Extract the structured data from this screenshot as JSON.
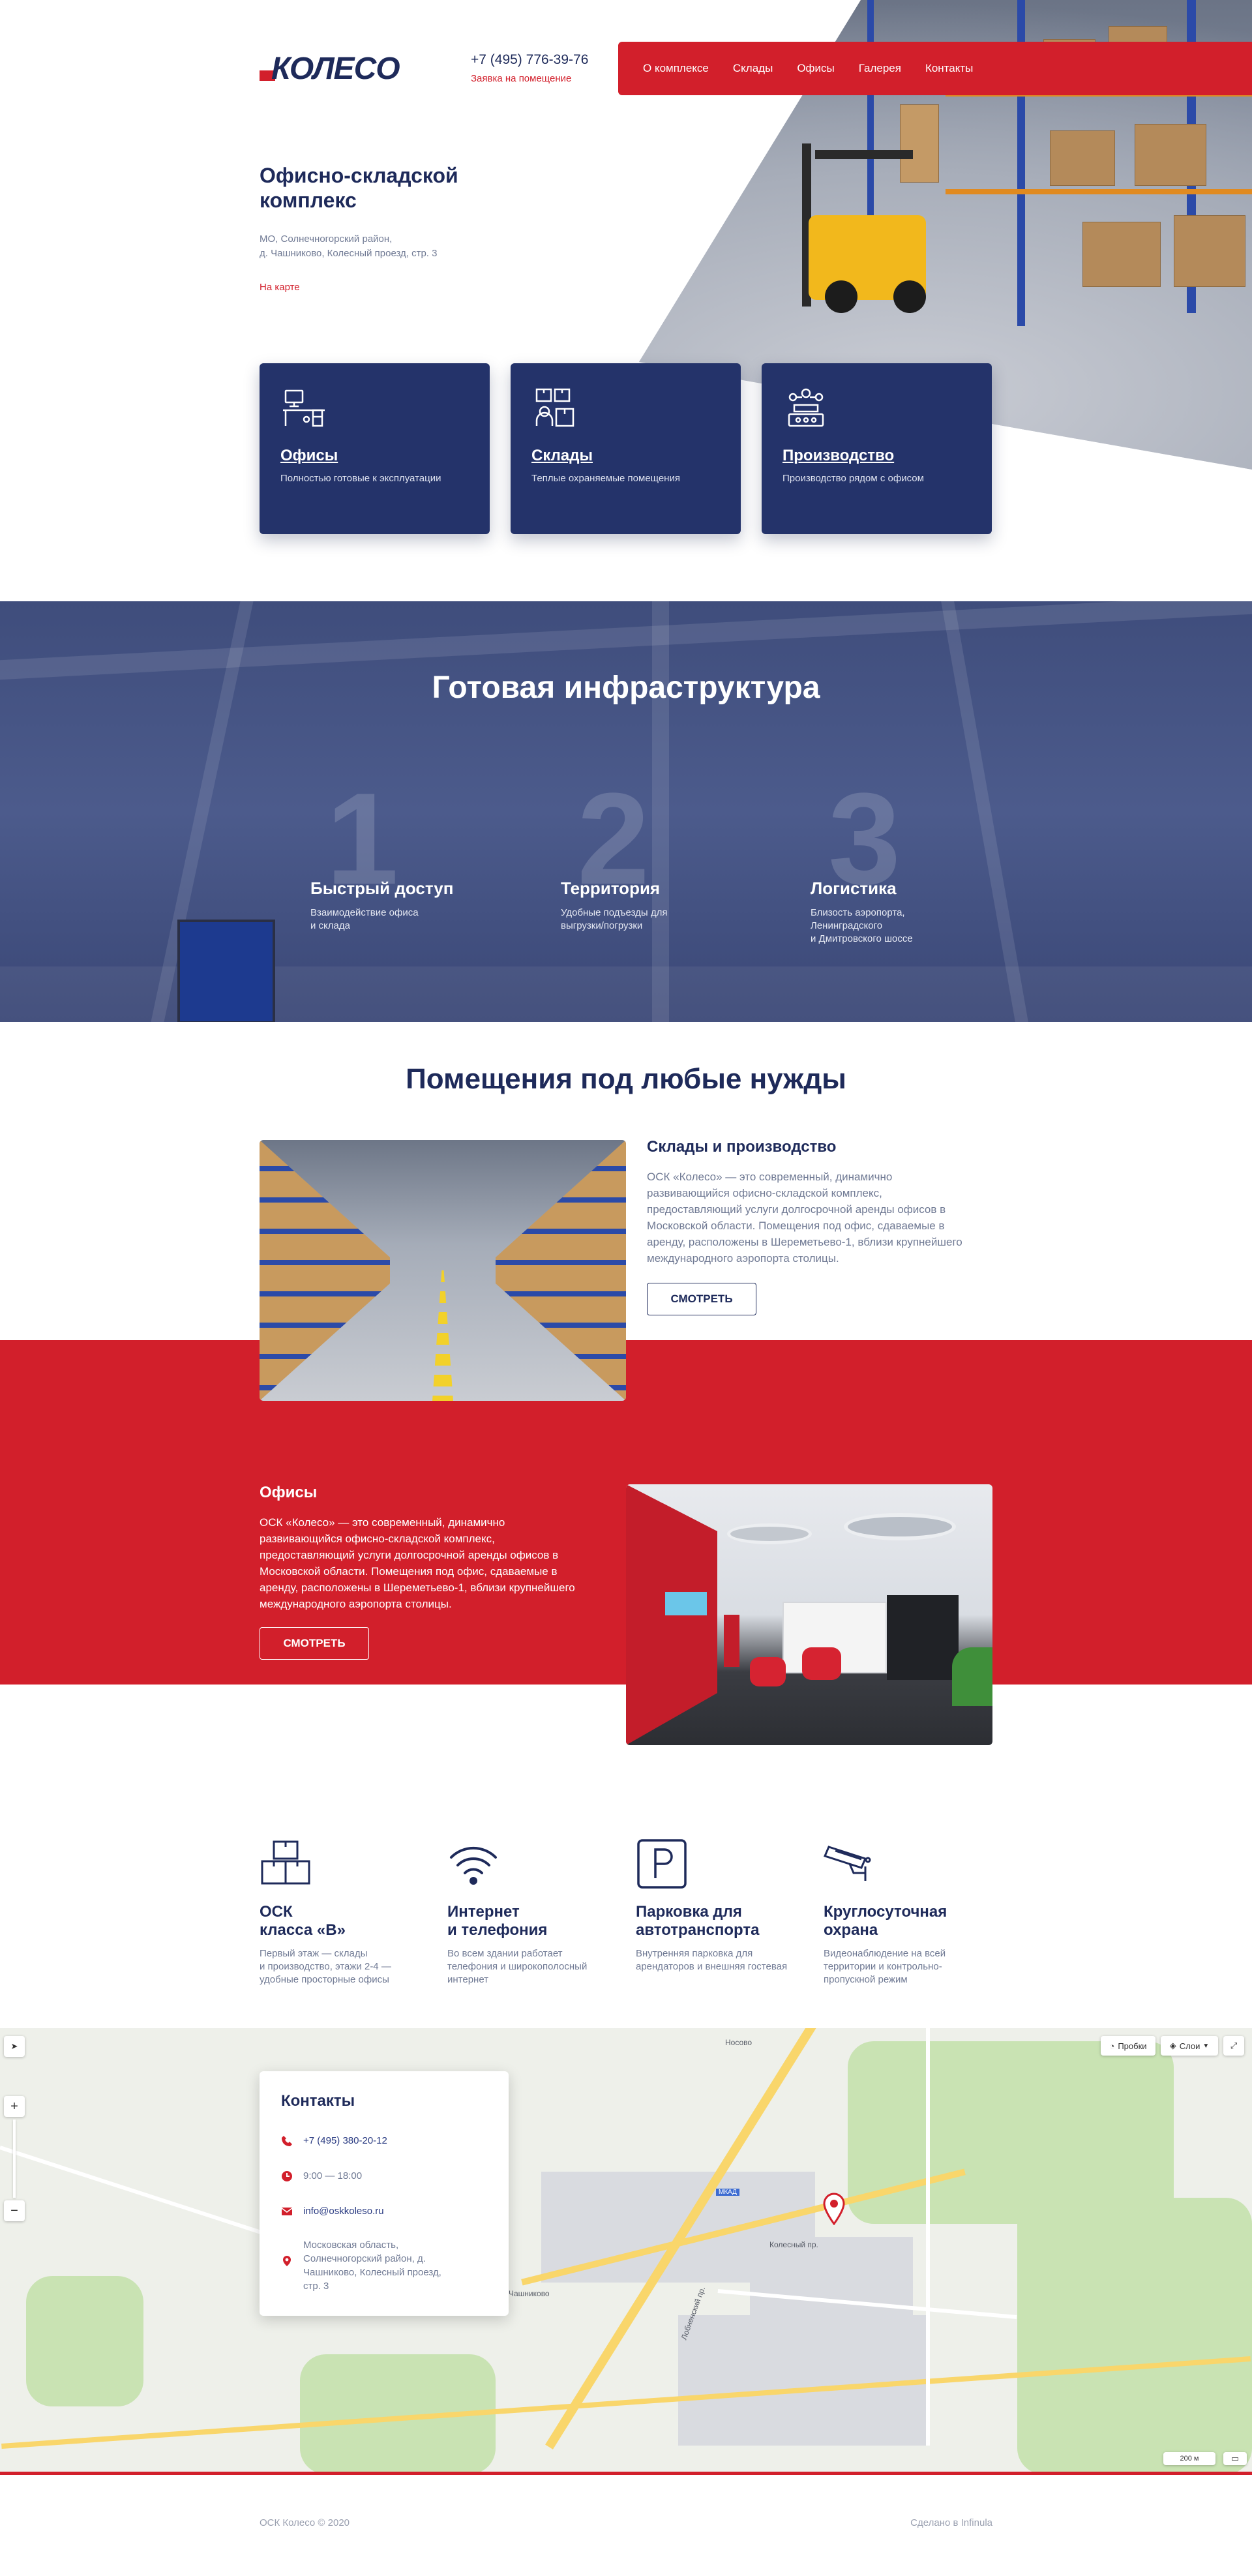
{
  "header": {
    "logo_text": "КОЛЕСО",
    "phone": "+7 (495) 776-39-76",
    "request_link": "Заявка на помещение",
    "nav": [
      "О комплексе",
      "Склады",
      "Офисы",
      "Галерея",
      "Контакты"
    ]
  },
  "hero": {
    "title": "Офисно-складской комплекс",
    "address_line1": "МО, Солнечногорский район,",
    "address_line2": "д. Чашниково, Колесный проезд, стр. 3",
    "map_link": "На карте"
  },
  "cards": [
    {
      "title": "Офисы",
      "subtitle": "Полностью готовые к эксплуатации",
      "icon": "office-desk-icon"
    },
    {
      "title": "Склады",
      "subtitle": "Теплые охраняемые помещения",
      "icon": "warehouse-boxes-icon"
    },
    {
      "title": "Производство",
      "subtitle": "Производство рядом с офисом",
      "icon": "production-icon"
    }
  ],
  "infrastructure": {
    "title": "Готовая инфраструктура",
    "features": [
      {
        "num": "1",
        "title": "Быстрый доступ",
        "line1": "Взаимодействие офиса",
        "line2": "и склада",
        "line3": ""
      },
      {
        "num": "2",
        "title": "Территория",
        "line1": "Удобные подъезды для",
        "line2": "выгрузки/погрузки",
        "line3": ""
      },
      {
        "num": "3",
        "title": "Логистика",
        "line1": "Близость аэропорта,",
        "line2": "Ленинградского",
        "line3": "и Дмитровского шоссе"
      }
    ]
  },
  "rooms": {
    "title": "Помещения под любые нужды",
    "warehouses": {
      "title": "Склады и производство",
      "text": "ОСК «Колесо» — это современный, динамично развивающийся офисно-складской комплекс, предоставляющий услуги долгосрочной аренды офисов в Московской области. Помещения под офис, сдаваемые в аренду, расположены в Шереметьево-1, вблизи крупнейшего международного аэропорта столицы.",
      "button": "СМОТРЕТЬ"
    },
    "offices": {
      "title": "Офисы",
      "text": "ОСК «Колесо» — это современный, динамично развивающийся офисно-складской комплекс, предоставляющий услуги долгосрочной аренды офисов в Московской области. Помещения под офис, сдаваемые в аренду, расположены в Шереметьево-1, вблизи крупнейшего международного аэропорта столицы.",
      "button": "СМОТРЕТЬ"
    }
  },
  "amenities": [
    {
      "title1": "ОСК",
      "title2": "класса «В»",
      "line1": "Первый этаж — склады",
      "line2": "и производство, этажи 2-4 —",
      "line3": "удобные просторные офисы",
      "icon": "boxes-icon"
    },
    {
      "title1": "Интернет",
      "title2": "и телефония",
      "line1": "Во всем здании работает",
      "line2": "телефония и широкополосный",
      "line3": "интернет",
      "icon": "wifi-icon"
    },
    {
      "title1": "Парковка для",
      "title2": "автотранспорта",
      "line1": "Внутренняя парковка для",
      "line2": "арендаторов и внешняя гостевая",
      "line3": "",
      "icon": "parking-icon"
    },
    {
      "title1": "Круглосуточная",
      "title2": "охрана",
      "line1": "Видеонаблюдение на всей",
      "line2": "территории и контрольно-",
      "line3": "пропускной режим",
      "icon": "security-camera-icon"
    }
  ],
  "contacts": {
    "title": "Контакты",
    "phone": "+7 (495) 380-20-12",
    "hours": "9:00 — 18:00",
    "email": "info@oskkoleso.ru",
    "addr1": "Московская область,",
    "addr2": "Солнечногорский район, д.",
    "addr3": "Чашниково, Колесный проезд,",
    "addr4": "стр. 3"
  },
  "map": {
    "traffic_btn": "Пробки",
    "layers_btn": "Слои",
    "labels": [
      "Носово",
      "Чашниково",
      "Лобненский пр.",
      "Колесный пр.",
      "МКАД"
    ],
    "scale": "200 м"
  },
  "footer": {
    "copyright": "ОСК Колесо © 2020",
    "made_by": "Сделано в Infinula"
  },
  "colors": {
    "navy": "#1e2a5a",
    "card": "#24336a",
    "red": "#d21f2b"
  }
}
